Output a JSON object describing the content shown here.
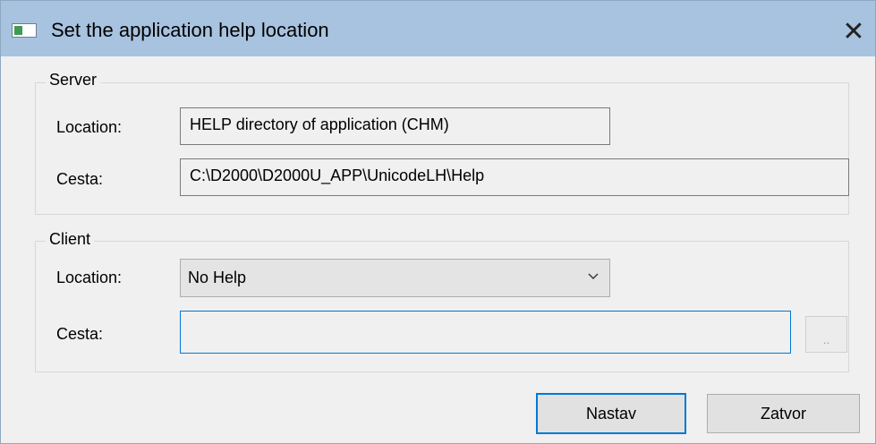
{
  "window": {
    "title": "Set the application help location",
    "close_label": "✕"
  },
  "server": {
    "legend": "Server",
    "location_label": "Location:",
    "location_value": "HELP directory of application (CHM)",
    "path_label": "Cesta:",
    "path_value": "C:\\D2000\\D2000U_APP\\UnicodeLH\\Help"
  },
  "client": {
    "legend": "Client",
    "location_label": "Location:",
    "location_value": "No Help",
    "path_label": "Cesta:",
    "path_value": "",
    "browse_label": ".."
  },
  "buttons": {
    "ok": "Nastav",
    "cancel": "Zatvor"
  },
  "icons": {
    "app": "window-app-icon",
    "close": "close-icon",
    "dropdown": "chevron-down-icon"
  },
  "colors": {
    "titlebar": "#a8c3df",
    "focus": "#0078d7"
  }
}
